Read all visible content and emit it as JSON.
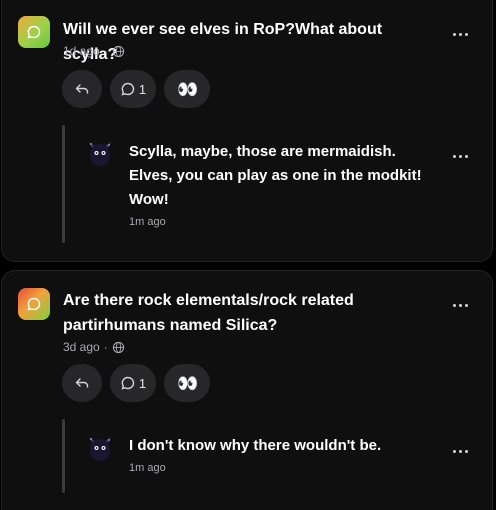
{
  "posts": [
    {
      "title": "Will we ever see elves in RoP?What about scylla?",
      "time": "1d ago",
      "separator": "·",
      "reply_count": "1",
      "reaction_emoji": "👀",
      "reply": {
        "text": "Scylla, maybe, those are mermaidish. Elves, you can play as one in the modkit! Wow!",
        "time": "1m ago"
      }
    },
    {
      "title": "Are there rock elementals/rock related partirhumans named Silica?",
      "time": "3d ago",
      "separator": "·",
      "reply_count": "1",
      "reaction_emoji": "👀",
      "reply": {
        "text": "I don't know why there wouldn't be.",
        "time": "1m ago"
      }
    }
  ],
  "icons": {
    "avatar": "chat-bubble-icon",
    "visibility": "globe-icon",
    "reply": "reply-arrow-icon",
    "comments": "comment-bubble-icon",
    "more": "more-horizontal-icon",
    "reply_avatar": "dark-creature-avatar"
  },
  "colors": {
    "background": "#000000",
    "card": "#0f0f10",
    "pill": "#27272a",
    "muted_text": "#a9a9ae"
  }
}
